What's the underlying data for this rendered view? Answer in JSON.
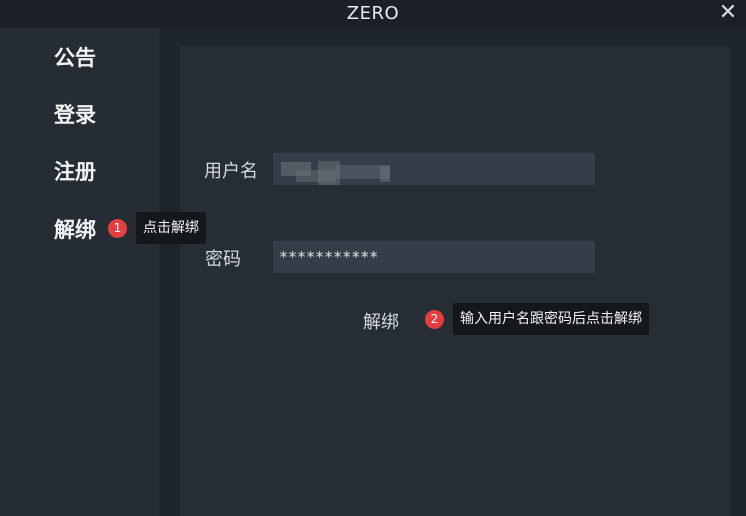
{
  "window": {
    "title": "ZERO",
    "close_glyph": "✕"
  },
  "sidebar": {
    "items": [
      {
        "label": "公告"
      },
      {
        "label": "登录"
      },
      {
        "label": "注册"
      },
      {
        "label": "解绑"
      }
    ]
  },
  "annotations": [
    {
      "number": "1",
      "text": "点击解绑"
    },
    {
      "number": "2",
      "text": "输入用户名跟密码后点击解绑"
    }
  ],
  "form": {
    "username_label": "用户名",
    "username_value": "",
    "password_label": "密码",
    "password_value": "***********",
    "submit_label": "解绑"
  },
  "colors": {
    "badge": "#e53e3e",
    "sidebar_bg": "#252c33",
    "panel_bg": "#262d35",
    "field_bg": "#343e48"
  }
}
